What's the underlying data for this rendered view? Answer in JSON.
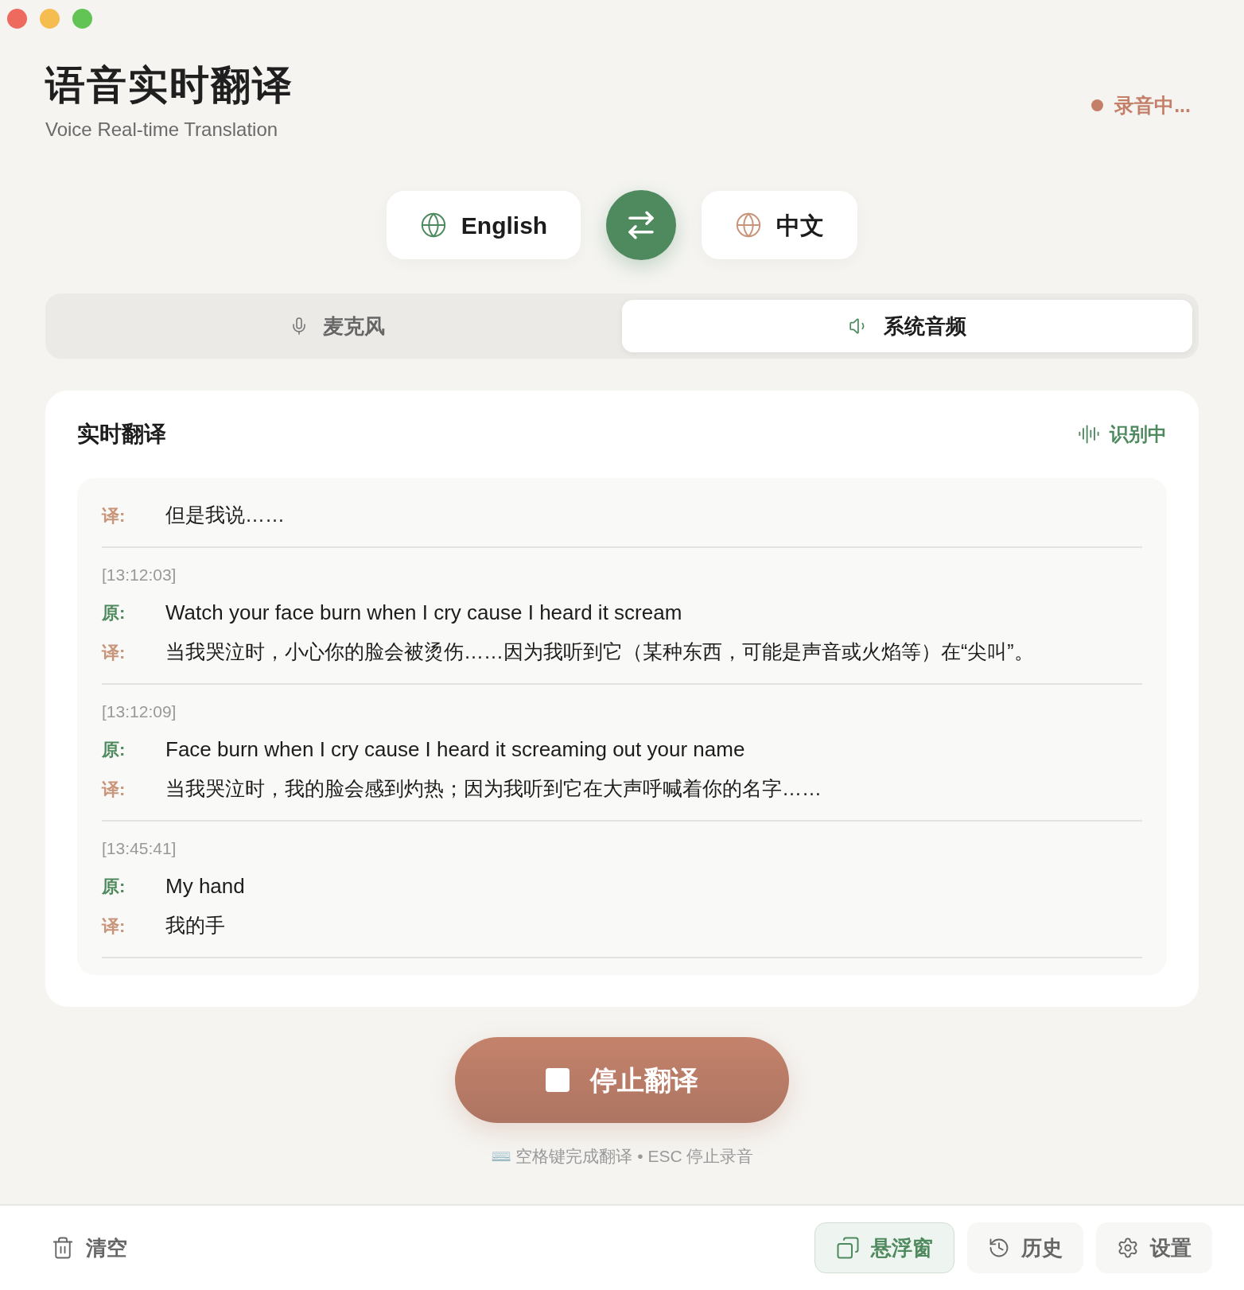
{
  "header": {
    "title": "语音实时翻译",
    "subtitle": "Voice Real-time Translation",
    "status": {
      "text": "录音中...",
      "color": "#c47f68"
    }
  },
  "languages": {
    "source": "English",
    "target": "中文"
  },
  "tabs": [
    {
      "label": "麦克风",
      "selected": false
    },
    {
      "label": "系统音频",
      "selected": true
    }
  ],
  "panel": {
    "title": "实时翻译",
    "status": "识别中",
    "entries": [
      {
        "translation_label": "译:",
        "translation": "但是我说……"
      },
      {
        "time": "[13:12:03]",
        "original_label": "原:",
        "original": "Watch your face burn when I cry cause I heard it scream",
        "translation_label": "译:",
        "translation": "当我哭泣时，小心你的脸会被烫伤……因为我听到它（某种东西，可能是声音或火焰等）在“尖叫”。"
      },
      {
        "time": "[13:12:09]",
        "original_label": "原:",
        "original": "Face burn when I cry cause I heard it screaming out your name",
        "translation_label": "译:",
        "translation": "当我哭泣时，我的脸会感到灼热；因为我听到它在大声呼喊着你的名字……"
      },
      {
        "time": "[13:45:41]",
        "original_label": "原:",
        "original": "My hand",
        "translation_label": "译:",
        "translation": "我的手"
      }
    ]
  },
  "stop_button": "停止翻译",
  "hint": "⌨️ 空格键完成翻译 • ESC 停止录音",
  "footer": {
    "clear": "清空",
    "buttons": [
      {
        "label": "悬浮窗",
        "selected": true
      },
      {
        "label": "历史",
        "selected": false
      },
      {
        "label": "设置",
        "selected": false
      }
    ]
  }
}
